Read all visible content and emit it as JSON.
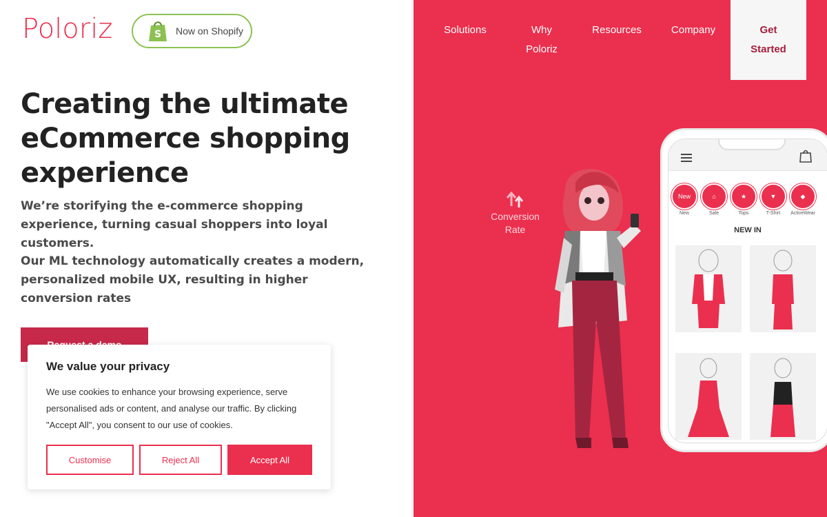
{
  "brand": {
    "logo_text": "Poloriz",
    "accent": "#eb2f4e",
    "dark_accent": "#c7294a",
    "shopify_green": "#8cc152"
  },
  "shopify_badge": {
    "label": "Now on Shopify",
    "icon": "shopify-bag-icon"
  },
  "nav": {
    "items": [
      {
        "label": "Solutions"
      },
      {
        "label": "Why Poloriz"
      },
      {
        "label": "Resources"
      },
      {
        "label": "Company"
      }
    ],
    "cta": "Get Started"
  },
  "hero": {
    "title": "Creating the ultimate eCommerce shopping experience",
    "subtitle": "We’re storifying the e-commerce shopping experience, turning casual shoppers into loyal customers.",
    "subtitle2": "Our ML technology automatically creates a modern, personalized mobile UX, resulting in higher conversion rates",
    "demo_button": "Request a demo"
  },
  "illustration": {
    "conversion_label": "Conversion Rate",
    "phone": {
      "categories": [
        {
          "label": "New",
          "badge": "New"
        },
        {
          "label": "Sale",
          "badge": ""
        },
        {
          "label": "Tops",
          "badge": ""
        },
        {
          "label": "T-Shirt",
          "badge": ""
        },
        {
          "label": "ActiveWear",
          "badge": ""
        }
      ],
      "section_title": "NEW IN"
    }
  },
  "cookie": {
    "title": "We value your privacy",
    "body": "We use cookies to enhance your browsing experience, serve personalised ads or content, and analyse our traffic. By clicking \"Accept All\", you consent to our use of cookies.",
    "customise": "Customise",
    "reject": "Reject All",
    "accept": "Accept All"
  }
}
